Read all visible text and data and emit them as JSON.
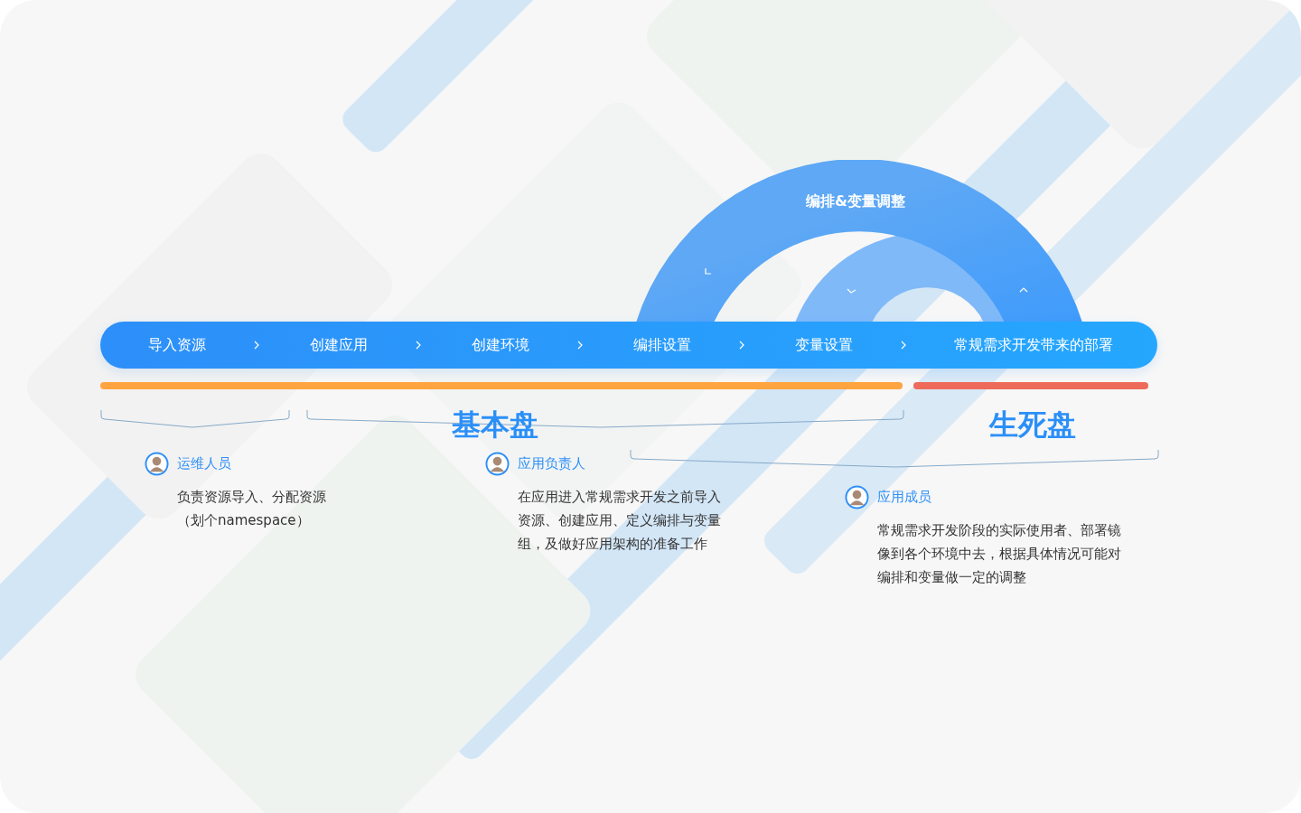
{
  "arc": {
    "label": "编排&变量调整"
  },
  "steps": [
    {
      "label": "导入资源"
    },
    {
      "label": "创建应用"
    },
    {
      "label": "创建环境"
    },
    {
      "label": "编排设置"
    },
    {
      "label": "变量设置"
    },
    {
      "label": "常规需求开发带来的部署"
    }
  ],
  "phases": [
    {
      "title": "基本盘",
      "color": "#ffa43f"
    },
    {
      "title": "生死盘",
      "color": "#ee6a5b"
    }
  ],
  "roles": [
    {
      "name": "运维人员",
      "lines": [
        "负责资源导入、分配资源",
        "（划个namespace）"
      ]
    },
    {
      "name": "应用负责人",
      "lines": [
        "在应用进入常规需求开发之前导入",
        "资源、创建应用、定义编排与变量",
        "组，及做好应用架构的准备工作"
      ]
    },
    {
      "name": "应用成员",
      "lines": [
        "常规需求开发阶段的实际使用者、部署镜",
        "像到各个环境中去，根据具体情况可能对",
        "编排和变量做一定的调整"
      ]
    }
  ]
}
